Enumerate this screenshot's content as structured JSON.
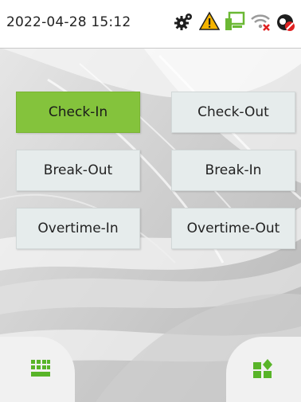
{
  "status_bar": {
    "datetime": "2022-04-28 15:12",
    "icons": [
      "gears-icon",
      "warning-icon",
      "network-icon",
      "wifi-disconnected-icon",
      "cloud-disconnected-icon"
    ]
  },
  "buttons": [
    {
      "label": "Check-In",
      "active": true
    },
    {
      "label": "Check-Out",
      "active": false
    },
    {
      "label": "Break-Out",
      "active": false
    },
    {
      "label": "Break-In",
      "active": false
    },
    {
      "label": "Overtime-In",
      "active": false
    },
    {
      "label": "Overtime-Out",
      "active": false
    }
  ],
  "bottom_left": {
    "icon": "keypad-icon"
  },
  "bottom_right": {
    "icon": "shortcut-menu-icon"
  },
  "colors": {
    "active_button": "#84c33c",
    "button": "#e6ecec",
    "icon_green": "#58b428",
    "warning": "#f5b400",
    "network": "#6bb834",
    "error_red": "#e02020"
  }
}
